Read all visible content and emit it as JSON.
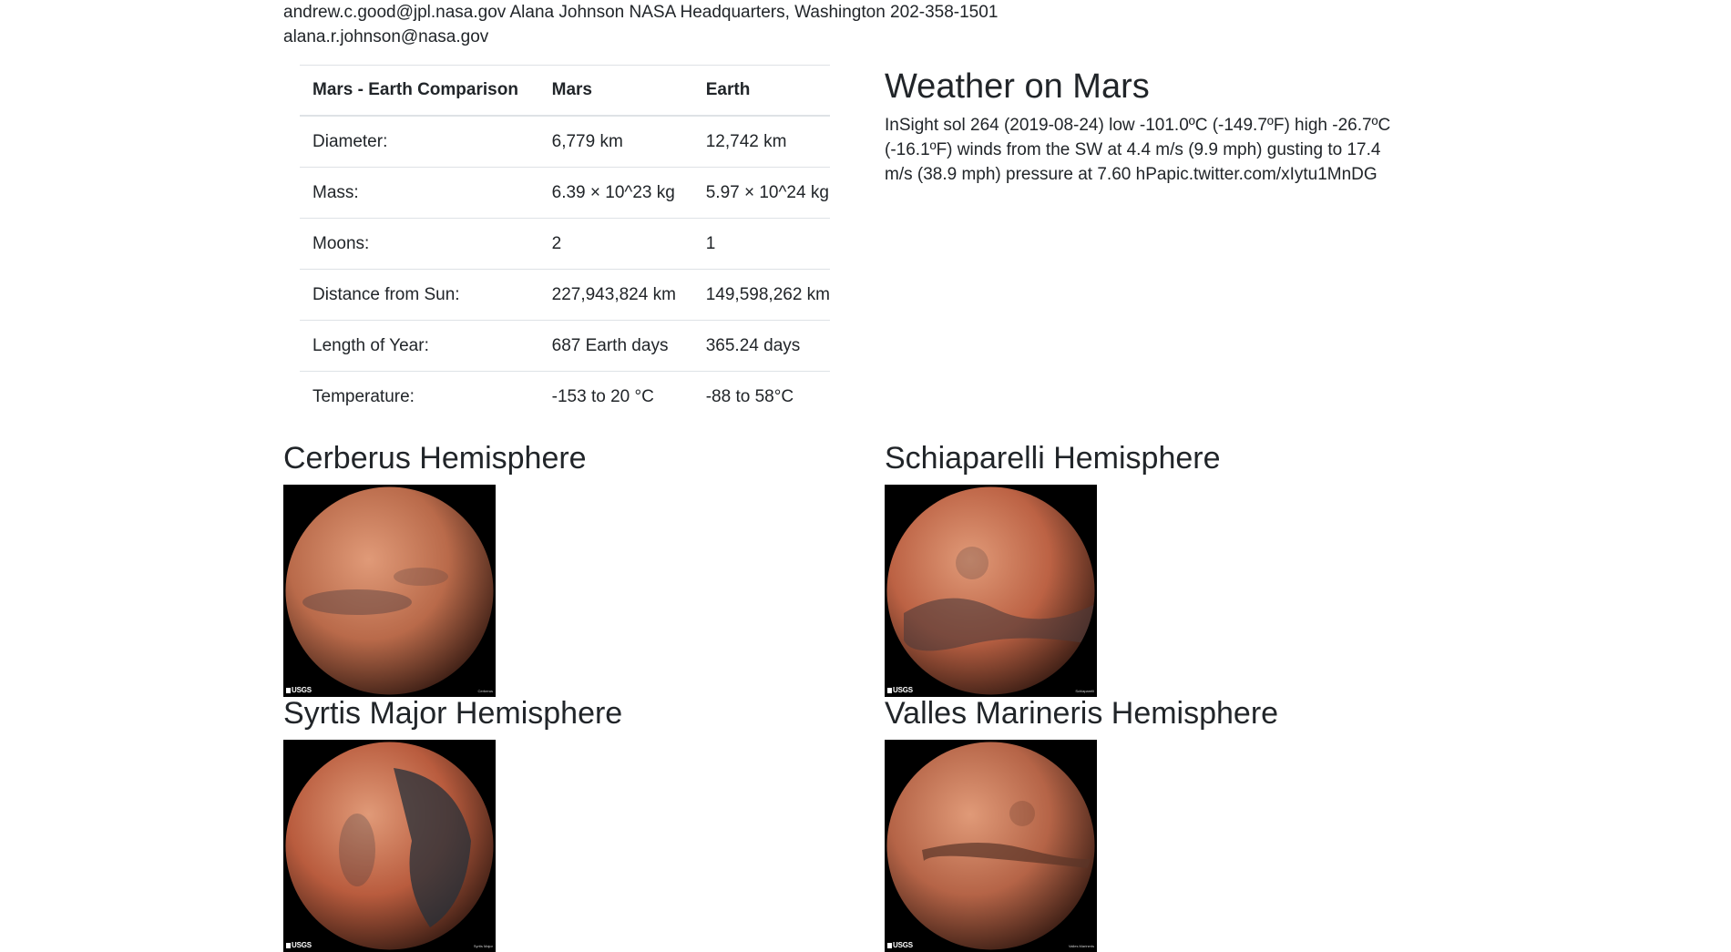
{
  "contact": {
    "line1": "andrew.c.good@jpl.nasa.gov Alana Johnson NASA Headquarters, Washington 202-358-1501",
    "line2": "alana.r.johnson@nasa.gov"
  },
  "comparison": {
    "headers": [
      "Mars - Earth Comparison",
      "Mars",
      "Earth"
    ],
    "rows": [
      [
        "Diameter:",
        "6,779 km",
        "12,742 km"
      ],
      [
        "Mass:",
        "6.39 × 10^23 kg",
        "5.97 × 10^24 kg"
      ],
      [
        "Moons:",
        "2",
        "1"
      ],
      [
        "Distance from Sun:",
        "227,943,824 km",
        "149,598,262 km"
      ],
      [
        "Length of Year:",
        "687 Earth days",
        "365.24 days"
      ],
      [
        "Temperature:",
        "-153 to 20 °C",
        "-88 to 58°C"
      ]
    ]
  },
  "weather": {
    "title": "Weather on Mars",
    "text": "InSight sol 264 (2019-08-24) low -101.0ºC (-149.7ºF) high -26.7ºC (-16.1ºF) winds from the SW at 4.4 m/s (9.9 mph) gusting to 17.4 m/s (38.9 mph) pressure at 7.60 hPapic.twitter.com/xIytu1MnDG"
  },
  "hemispheres": [
    {
      "title": "Cerberus Hemisphere",
      "logo": "USGS",
      "caption": "Cerberus",
      "base": "#b96a4a",
      "dark": "#6a4a45"
    },
    {
      "title": "Schiaparelli Hemisphere",
      "logo": "USGS",
      "caption": "Schiaparelli",
      "base": "#bc6244",
      "dark": "#4d3a3a"
    },
    {
      "title": "Syrtis Major Hemisphere",
      "logo": "USGS",
      "caption": "Syrtis Major",
      "base": "#b95c3e",
      "dark": "#26303a"
    },
    {
      "title": "Valles Marineris Hemisphere",
      "logo": "USGS",
      "caption": "Valles Marineris",
      "base": "#b56447",
      "dark": "#5a3428"
    }
  ]
}
